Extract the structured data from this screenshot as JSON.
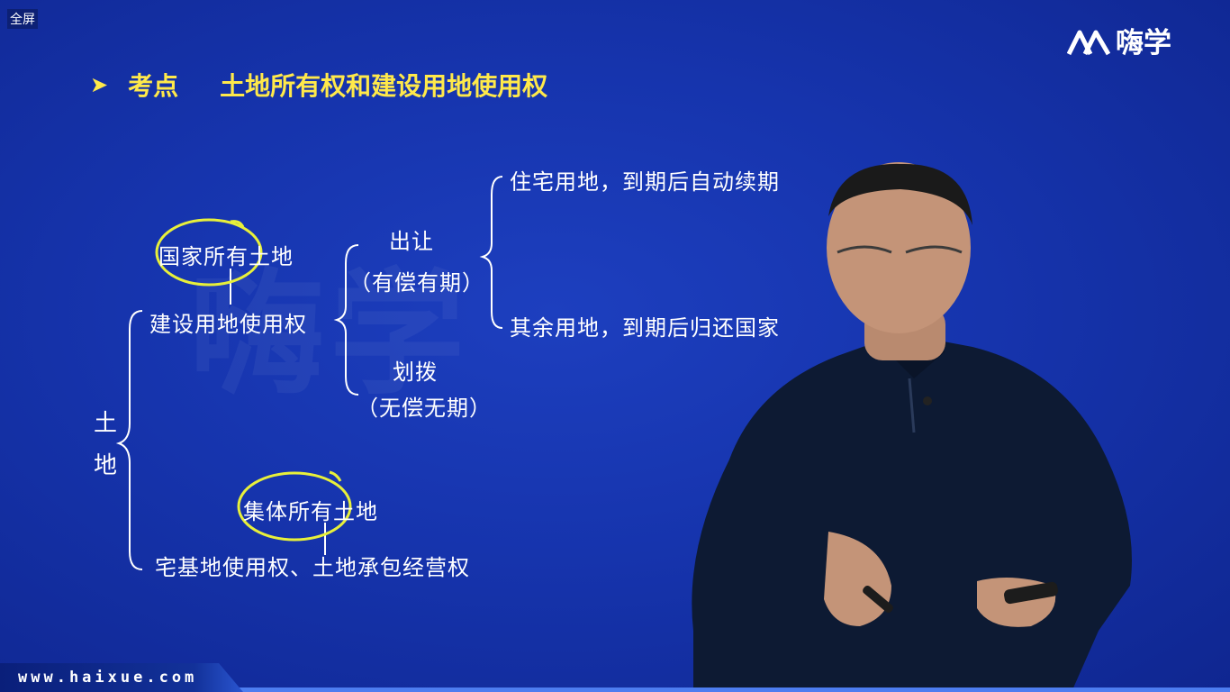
{
  "top_left": {
    "fullscreen_label": "全屏"
  },
  "brand": {
    "name": "嗨学"
  },
  "slide": {
    "heading_marker": "考点",
    "heading_title": "土地所有权和建设用地使用权",
    "watermark": "嗨学",
    "diagram": {
      "root_char1": "土",
      "root_char2": "地",
      "state_owned": "国家所有土地",
      "construction_right": "建设用地使用权",
      "transfer": "出让",
      "transfer_note": "（有偿有期）",
      "allocation": "划拨",
      "allocation_note": "（无偿无期）",
      "residential": "住宅用地，到期后自动续期",
      "other_land": "其余用地，到期后归还国家",
      "collective_owned": "集体所有土地",
      "collective_rights": "宅基地使用权、土地承包经营权"
    }
  },
  "footer": {
    "url": "www.haixue.com"
  },
  "colors": {
    "background": "#1634ad",
    "heading": "#ffe94a",
    "highlight_circle": "#e8f03a",
    "footer_bar": "#4d7df0"
  }
}
